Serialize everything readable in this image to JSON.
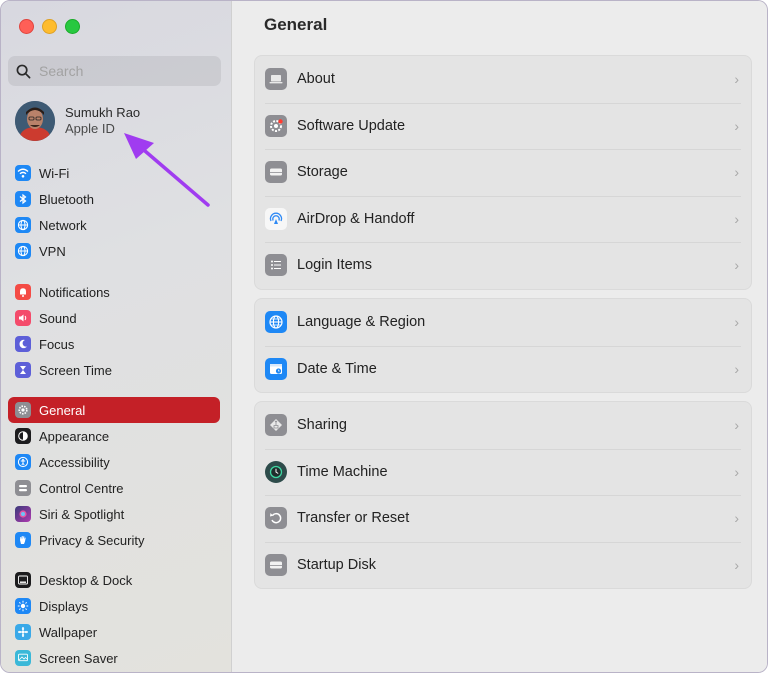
{
  "window": {
    "title": "General"
  },
  "search": {
    "placeholder": "Search"
  },
  "profile": {
    "name": "Sumukh Rao",
    "subtitle": "Apple ID"
  },
  "sidebar": {
    "groups": [
      [
        {
          "label": "Wi-Fi",
          "icon": "wifi-icon",
          "color": "#1e88f5"
        },
        {
          "label": "Bluetooth",
          "icon": "bluetooth-icon",
          "color": "#1e88f5"
        },
        {
          "label": "Network",
          "icon": "globe-icon",
          "color": "#1e88f5"
        },
        {
          "label": "VPN",
          "icon": "vpn-globe-icon",
          "color": "#1e88f5"
        }
      ],
      [
        {
          "label": "Notifications",
          "icon": "bell-icon",
          "color": "#f44b45"
        },
        {
          "label": "Sound",
          "icon": "speaker-icon",
          "color": "#f44b6b"
        },
        {
          "label": "Focus",
          "icon": "moon-icon",
          "color": "#5d5fd8"
        },
        {
          "label": "Screen Time",
          "icon": "hourglass-icon",
          "color": "#5d5fd8"
        }
      ],
      [
        {
          "label": "General",
          "icon": "gear-icon",
          "color": "#8e8e93",
          "active": true
        },
        {
          "label": "Appearance",
          "icon": "appearance-icon",
          "color": "#1c1c1e"
        },
        {
          "label": "Accessibility",
          "icon": "accessibility-icon",
          "color": "#1e88f5"
        },
        {
          "label": "Control Centre",
          "icon": "control-centre-icon",
          "color": "#8e8e93"
        },
        {
          "label": "Siri & Spotlight",
          "icon": "siri-icon",
          "color": "#3a3a7a"
        },
        {
          "label": "Privacy & Security",
          "icon": "hand-icon",
          "color": "#1e88f5"
        }
      ],
      [
        {
          "label": "Desktop & Dock",
          "icon": "dock-icon",
          "color": "#1c1c1e"
        },
        {
          "label": "Displays",
          "icon": "sun-icon",
          "color": "#1e88f5"
        },
        {
          "label": "Wallpaper",
          "icon": "wallpaper-icon",
          "color": "#3aa9e8"
        },
        {
          "label": "Screen Saver",
          "icon": "screensaver-icon",
          "color": "#3ab8d8"
        }
      ]
    ]
  },
  "main": {
    "title": "General",
    "groups": [
      [
        {
          "label": "About",
          "icon": "laptop-icon"
        },
        {
          "label": "Software Update",
          "icon": "gear-badge-icon"
        },
        {
          "label": "Storage",
          "icon": "drive-icon"
        },
        {
          "label": "AirDrop & Handoff",
          "icon": "airdrop-icon"
        },
        {
          "label": "Login Items",
          "icon": "list-icon"
        }
      ],
      [
        {
          "label": "Language & Region",
          "icon": "globe-icon"
        },
        {
          "label": "Date & Time",
          "icon": "calendar-clock-icon"
        }
      ],
      [
        {
          "label": "Sharing",
          "icon": "sharing-icon"
        },
        {
          "label": "Time Machine",
          "icon": "time-machine-icon"
        },
        {
          "label": "Transfer or Reset",
          "icon": "reset-icon"
        },
        {
          "label": "Startup Disk",
          "icon": "disk-icon"
        }
      ]
    ]
  },
  "colors": {
    "accent": "#c42027",
    "annotation_arrow": "#a03cf0"
  }
}
